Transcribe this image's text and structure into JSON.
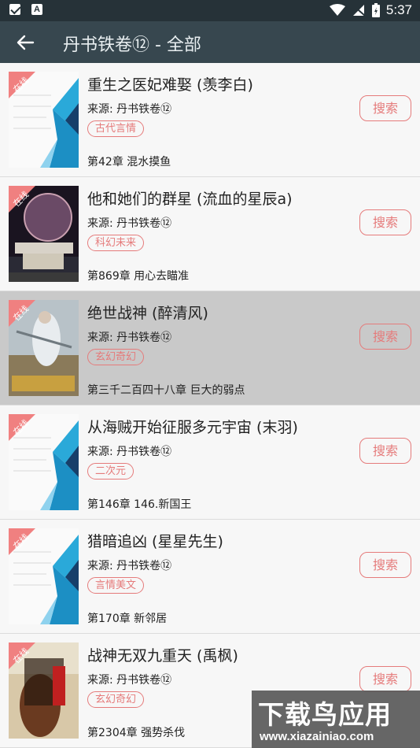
{
  "status_bar": {
    "time": "5:37"
  },
  "toolbar": {
    "title": "丹书铁卷⑫ - 全部"
  },
  "cover_badge": "在线",
  "books": [
    {
      "title": "重生之医妃难娶 (羡李白)",
      "source": "来源: 丹书铁卷⑫",
      "tag": "古代言情",
      "chapter": "第42章 混水摸鱼",
      "button": "搜索",
      "cover": "placeholder-cover"
    },
    {
      "title": "他和她们的群星 (流血的星辰a)",
      "source": "来源: 丹书铁卷⑫",
      "tag": "科幻未来",
      "chapter": "第869章 用心去瞄准",
      "button": "搜索",
      "cover": "space-cover"
    },
    {
      "title": "绝世战神 (醉清风)",
      "source": "来源: 丹书铁卷⑫",
      "tag": "玄幻奇幻",
      "chapter": "第三千二百四十八章 巨大的弱点",
      "button": "搜索",
      "cover": "warrior-cover"
    },
    {
      "title": "从海贼开始征服多元宇宙 (末羽)",
      "source": "来源: 丹书铁卷⑫",
      "tag": "二次元",
      "chapter": "第146章 146.新国王",
      "button": "搜索",
      "cover": "placeholder-cover"
    },
    {
      "title": "猎暗追凶 (星星先生)",
      "source": "来源: 丹书铁卷⑫",
      "tag": "言情美文",
      "chapter": "第170章 新邻居",
      "button": "搜索",
      "cover": "placeholder-cover"
    },
    {
      "title": "战神无双九重天 (禹枫)",
      "source": "来源: 丹书铁卷⑫",
      "tag": "玄幻奇幻",
      "chapter": "第2304章 强势杀伐",
      "button": "搜索",
      "cover": "fantasy-cover"
    }
  ],
  "watermark": {
    "main": "下载鸟应用",
    "url": "www.xiazainiao.com"
  },
  "colors": {
    "toolbar": "#37474f",
    "statusbar": "#263238",
    "accent": "#e57b7b",
    "selected_row": "#c9c9c9"
  }
}
